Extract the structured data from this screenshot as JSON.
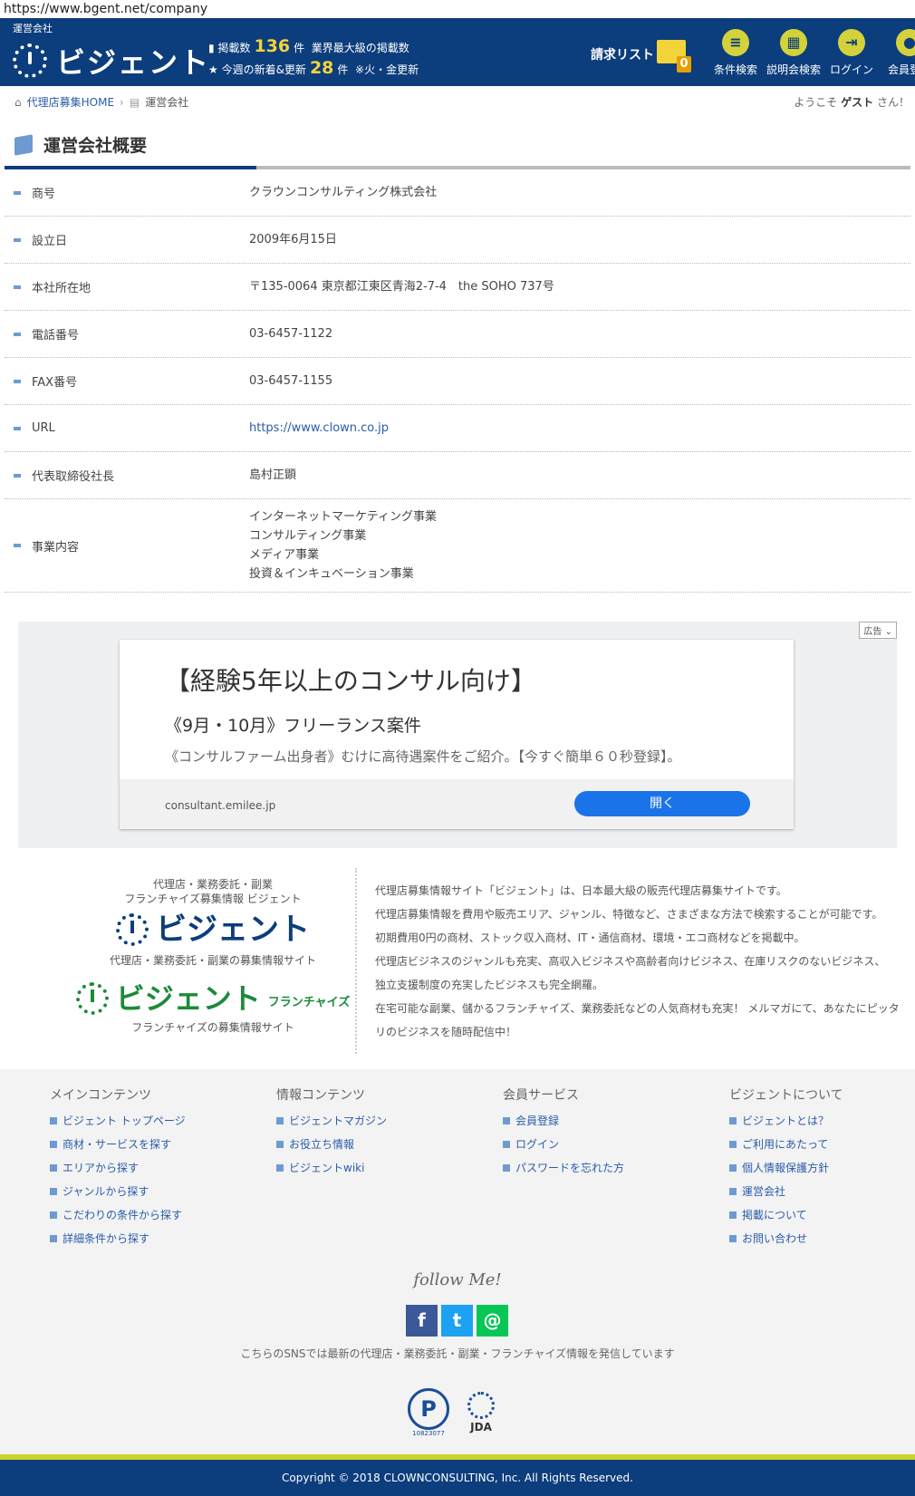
{
  "browser": {
    "url": "https://www.bgent.net/company"
  },
  "header": {
    "caption": "運営会社",
    "logo": "ビジェント",
    "stats": {
      "listing_label": "掲載数",
      "listing_count": "136",
      "listing_unit": "件",
      "listing_tag": "業界最大級の掲載数",
      "new_label": "今週の新着&更新",
      "new_count": "28",
      "new_unit": "件",
      "new_note": "※火・金更新"
    },
    "request_list": "請求リスト",
    "request_count": "0",
    "nav": [
      {
        "label": "条件検索",
        "icon": "list-icon"
      },
      {
        "label": "説明会検索",
        "icon": "calendar-icon"
      },
      {
        "label": "ログイン",
        "icon": "login-icon"
      },
      {
        "label": "会員登録",
        "icon": "user-icon"
      }
    ]
  },
  "breadcrumb": {
    "home": "代理店募集HOME",
    "current": "運営会社"
  },
  "welcome": {
    "prefix": "ようこそ",
    "name": "ゲスト",
    "suffix": "さん！"
  },
  "page_title": "運営会社概要",
  "company": {
    "rows": [
      {
        "key": "商号",
        "value": "クラウンコンサルティング株式会社"
      },
      {
        "key": "設立日",
        "value": "2009年6月15日"
      },
      {
        "key": "本社所在地",
        "value": "〒135-0064 東京都江東区青海2-7-4　the SOHO 737号"
      },
      {
        "key": "電話番号",
        "value": "03-6457-1122"
      },
      {
        "key": "FAX番号",
        "value": "03-6457-1155"
      },
      {
        "key": "URL",
        "value": "https://www.clown.co.jp"
      },
      {
        "key": "代表取締役社長",
        "value": "島村正顕"
      }
    ],
    "business_key": "事業内容",
    "business": [
      "インターネットマーケティング事業",
      "コンサルティング事業",
      "メディア事業",
      "投資＆インキュベーション事業"
    ]
  },
  "ad": {
    "tag": "広告",
    "headline": "【経験5年以上のコンサル向け】",
    "subhead": "《9月・10月》フリーランス案件",
    "body": "《コンサルファーム出身者》むけに高待遇案件をご紹介。【今すぐ簡単６０秒登録】。",
    "domain": "consultant.emilee.jp",
    "button": "開く"
  },
  "about": {
    "tagline1": "代理店・業務委託・副業",
    "tagline2": "フランチャイズ募集情報 ビジェント",
    "logo1": "ビジェント",
    "caption1": "代理店・業務委託・副業の募集情報サイト",
    "logo2": "ビジェント",
    "logo2_suffix": "フランチャイズ",
    "caption2": "フランチャイズの募集情報サイト",
    "lines": [
      "代理店募集情報サイト「ビジェント」は、日本最大級の販売代理店募集サイトです。",
      "代理店募集情報を費用や販売エリア、ジャンル、特徴など、さまざまな方法で検索することが可能です。",
      "初期費用0円の商材、ストック収入商材、IT・通信商材、環境・エコ商材などを掲載中。",
      "代理店ビジネスのジャンルも充実、高収入ビジネスや高齢者向けビジネス、在庫リスクのないビジネス、",
      "独立支援制度の充実したビジネスも完全網羅。",
      "在宅可能な副業、儲かるフランチャイズ、業務委託などの人気商材も充実！ メルマガにて、あなたにピッタ",
      "リのビジネスを随時配信中！"
    ]
  },
  "footer": {
    "columns": [
      {
        "title": "メインコンテンツ",
        "items": [
          "ビジェント トップページ",
          "商材・サービスを探す",
          "エリアから探す",
          "ジャンルから探す",
          "こだわりの条件から探す",
          "詳細条件から探す"
        ]
      },
      {
        "title": "情報コンテンツ",
        "items": [
          "ビジェントマガジン",
          "お役立ち情報",
          "ビジェントwiki"
        ]
      },
      {
        "title": "会員サービス",
        "items": [
          "会員登録",
          "ログイン",
          "パスワードを忘れた方"
        ]
      },
      {
        "title": "ビジェントについて",
        "items": [
          "ビジェントとは？",
          "ご利用にあたって",
          "個人情報保護方針",
          "運営会社",
          "掲載について",
          "お問い合わせ"
        ]
      }
    ],
    "follow": "follow Me!",
    "sns": [
      {
        "icon": "facebook-icon",
        "glyph": "f",
        "color": "#3b5998"
      },
      {
        "icon": "twitter-icon",
        "glyph": "t",
        "color": "#1da1f2"
      },
      {
        "icon": "mail-icon",
        "glyph": "@",
        "color": "#06c755"
      }
    ],
    "sns_text": "こちらのSNSでは最新の代理店・業務委託・副業・フランチャイズ情報を発信しています",
    "privacy_mark": "P",
    "privacy_number": "10823077",
    "jda": "JDA",
    "copyright": "Copyright © 2018 CLOWNCONSULTING, Inc. All Rights Reserved."
  }
}
